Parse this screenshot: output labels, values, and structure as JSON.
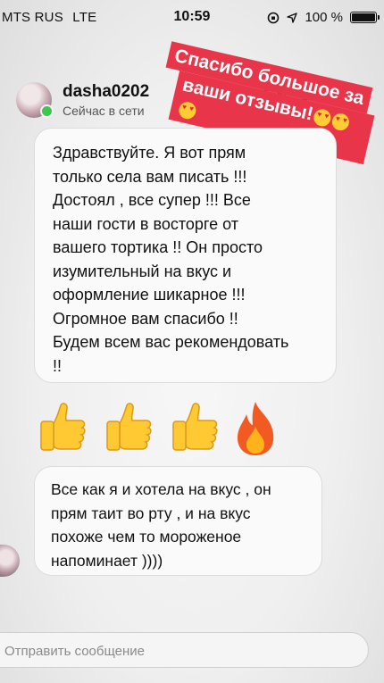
{
  "status_bar": {
    "carrier": "MTS RUS",
    "network": "LTE",
    "time": "10:59",
    "battery": "100 %",
    "battery_level": 1.0
  },
  "header": {
    "username": "dasha0202",
    "status": "Сейчас в сети",
    "icons": [
      "back-avatar",
      "flag-icon",
      "info-icon"
    ],
    "online_color": "#3cc84a"
  },
  "sticker": {
    "line1": "Спасибо большое за",
    "line2": "ваши отзывы!",
    "background": "#e8354a"
  },
  "messages": [
    {
      "lines": [
        "Здравствуйте. Я вот прям",
        "только села вам писать !!!",
        "Достоял , все супер !!! Все",
        "наши гости в восторге от",
        "вашего тортика !! Он просто",
        "изумительный на вкус и",
        "оформление шикарное !!!",
        "Огромное вам спасибо !!",
        "Будем всем вас рекомендовать",
        "!!"
      ]
    },
    {
      "lines": [
        "Все как я и хотела на вкус , он",
        "прям таит во рту , и на вкус",
        "похоже чем то  мороженое",
        "напоминает ))))"
      ]
    }
  ],
  "emoji_row": [
    "thumbs-up",
    "thumbs-up",
    "thumbs-up",
    "fire"
  ],
  "composer": {
    "placeholder": "Отправить сообщение"
  }
}
